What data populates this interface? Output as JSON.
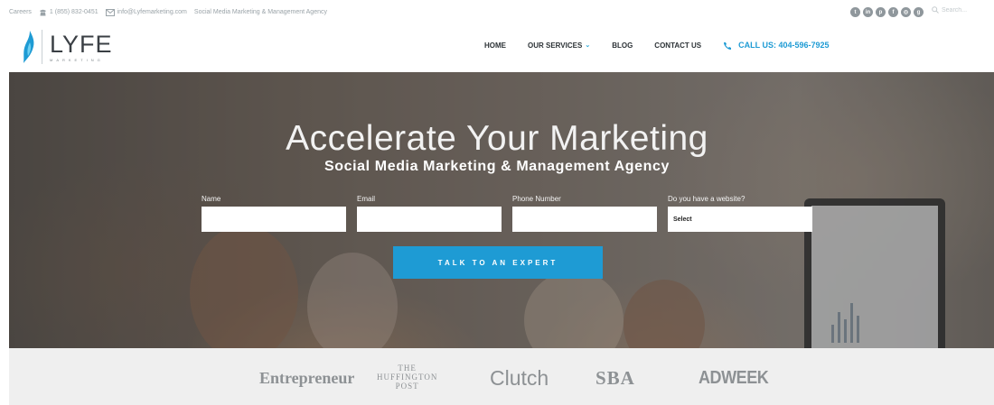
{
  "topbar": {
    "careers": "Careers",
    "phone": "1 (855) 832-0451",
    "email": "info@Lyfemarketing.com",
    "tagline": "Social Media Marketing & Management Agency",
    "search_placeholder": "Search...",
    "social_icons": [
      "twitter-icon",
      "linkedin-icon",
      "pinterest-icon",
      "facebook-icon",
      "instagram-icon",
      "google-plus-icon"
    ]
  },
  "header": {
    "logo_text": "LYFE",
    "logo_sub": "MARKETING",
    "nav": {
      "home": "HOME",
      "services": "OUR SERVICES",
      "blog": "BLOG",
      "contact": "CONTACT US",
      "call": "CALL US: 404-596-7925"
    }
  },
  "hero": {
    "headline": "Accelerate Your Marketing",
    "subheadline": "Social Media Marketing & Management Agency",
    "form": {
      "name_label": "Name",
      "email_label": "Email",
      "phone_label": "Phone Number",
      "website_label": "Do you have a website?",
      "website_selected": "Select"
    },
    "cta_label": "TALK TO AN EXPERT"
  },
  "press": {
    "entrepreneur": "Entrepreneur",
    "huffington_1": "THE",
    "huffington_2": "HUFFINGTON",
    "huffington_3": "POST",
    "clutch": "Clutch",
    "sba": "SBA",
    "adweek": "ADWEEK"
  },
  "colors": {
    "accent": "#1e9bd4",
    "nav_text": "#2c3236",
    "press_bg": "#efefef"
  }
}
